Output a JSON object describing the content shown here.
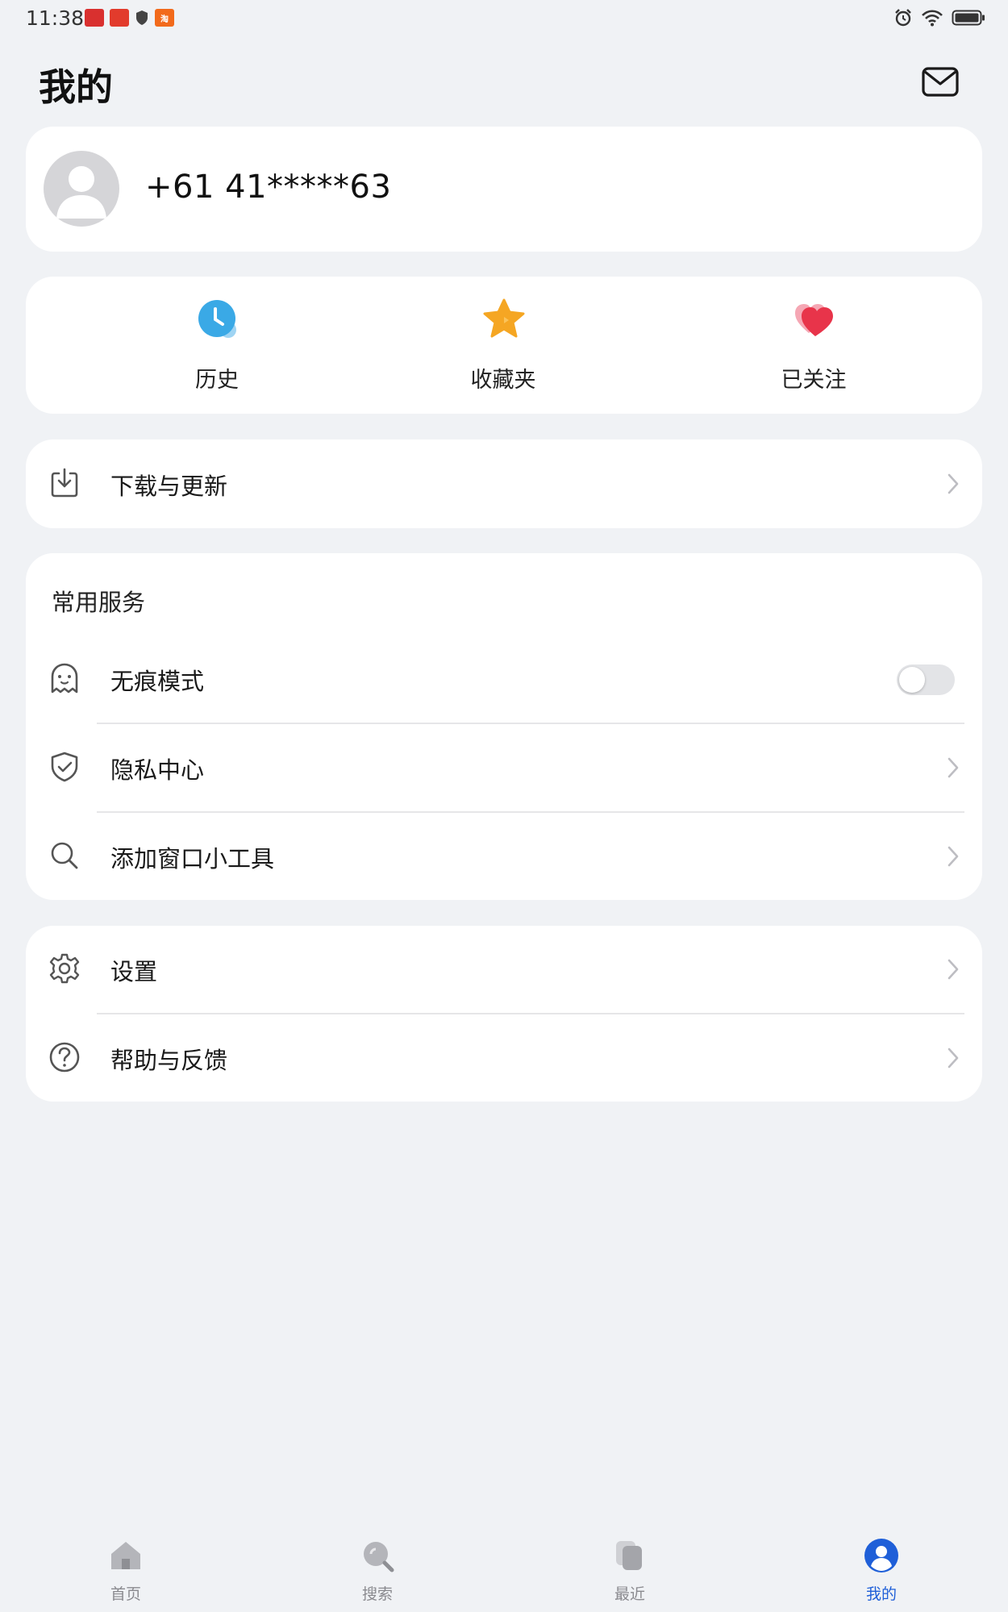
{
  "status_bar": {
    "time": "11:38",
    "notif_apps": [
      {
        "name": "app-notif-1",
        "text": "",
        "color": "#d9302f"
      },
      {
        "name": "app-notif-2",
        "text": "",
        "color": "#e23b2c"
      },
      {
        "name": "app-notif-4",
        "text": "淘",
        "color": "#f26a1b"
      }
    ]
  },
  "header": {
    "title": "我的"
  },
  "profile": {
    "phone": "+61 41*****63"
  },
  "quick_actions": [
    {
      "label": "历史"
    },
    {
      "label": "收藏夹"
    },
    {
      "label": "已关注"
    }
  ],
  "downloads": {
    "label": "下载与更新"
  },
  "services": {
    "title": "常用服务",
    "items": [
      {
        "label": "无痕模式",
        "toggle_on": false
      },
      {
        "label": "隐私中心"
      },
      {
        "label": "添加窗口小工具"
      }
    ]
  },
  "settings": {
    "items": [
      {
        "label": "设置"
      },
      {
        "label": "帮助与反馈"
      }
    ]
  },
  "bottom_nav": {
    "items": [
      {
        "label": "首页"
      },
      {
        "label": "搜索"
      },
      {
        "label": "最近"
      },
      {
        "label": "我的",
        "active": true
      }
    ]
  },
  "colors": {
    "background": "#f0f2f5",
    "card": "#ffffff",
    "accent": "#1f5fd8",
    "history_blue": "#3aa9e6",
    "star_orange": "#f5a623",
    "heart_red": "#e8344a"
  }
}
